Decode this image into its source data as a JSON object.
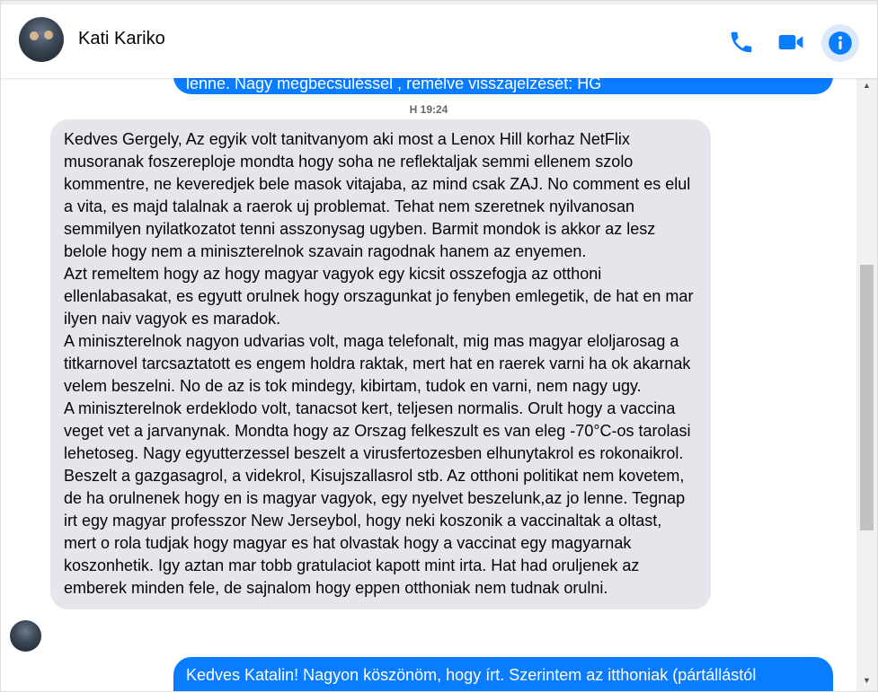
{
  "header": {
    "contact_name": "Kati Kariko",
    "icons": [
      "phone-icon",
      "video-icon",
      "info-icon"
    ],
    "accent_color": "#0a7cff"
  },
  "messages": {
    "previous_outgoing_tail": "lenne. Nagy megbecsüléssel , remélve visszajelzését: HG",
    "timestamp": "H 19:24",
    "incoming": {
      "paragraphs": [
        "Kedves Gergely, Az egyik volt tanitvanyom aki most a Lenox Hill korhaz NetFlix musoranak foszereploje mondta hogy soha ne reflektaljak semmi ellenem szolo kommentre, ne keveredjek bele masok vitajaba, az mind csak ZAJ. No comment es elul a vita, es majd talalnak a raerok uj problemat. Tehat nem szeretnek nyilvanosan semmilyen nyilatkozatot tenni asszonysag ugyben. Barmit mondok is akkor az lesz belole hogy nem a miniszterelnok szavain ragodnak hanem az enyemen.",
        "Azt remeltem hogy az hogy magyar vagyok  egy kicsit osszefogja az otthoni ellenlabasakat, es egyutt orulnek hogy orszagunkat jo fenyben emlegetik, de hat en mar ilyen naiv vagyok es maradok.",
        "A miniszterelnok nagyon udvarias volt, maga telefonalt, mig mas magyar eloljarosag a titkarnovel tarcsaztatott es engem holdra raktak, mert hat en raerek varni ha ok akarnak velem beszelni. No de az is tok mindegy, kibirtam, tudok en varni, nem nagy ugy.",
        "A miniszterelnok erdeklodo volt, tanacsot kert, teljesen normalis. Orult hogy a vaccina veget vet a jarvanynak. Mondta hogy az Orszag felkeszult es van eleg -70°C-os tarolasi lehetoseg. Nagy egyutterzessel beszelt a virusfertozesben elhunytakrol es rokonaikrol.  Beszelt a gazgasagrol, a videkrol,  Kisujszallasrol stb. Az otthoni politikat nem kovetem, de ha orulnenek hogy en is magyar vagyok, egy nyelvet beszelunk,az jo lenne. Tegnap irt egy magyar professzor New Jerseybol, hogy neki koszonik a vaccinaltak a oltast, mert o rola tudjak hogy magyar es hat olvastak hogy a vaccinat egy magyarnak koszonhetik. Igy aztan mar tobb gratulaciot kapott mint irta. Hat had oruljenek az emberek minden fele, de sajnalom hogy eppen otthoniak nem tudnak orulni."
      ]
    },
    "next_outgoing_head": "Kedves Katalin! Nagyon köszönöm, hogy írt. Szerintem az itthoniak (pártállástól"
  }
}
